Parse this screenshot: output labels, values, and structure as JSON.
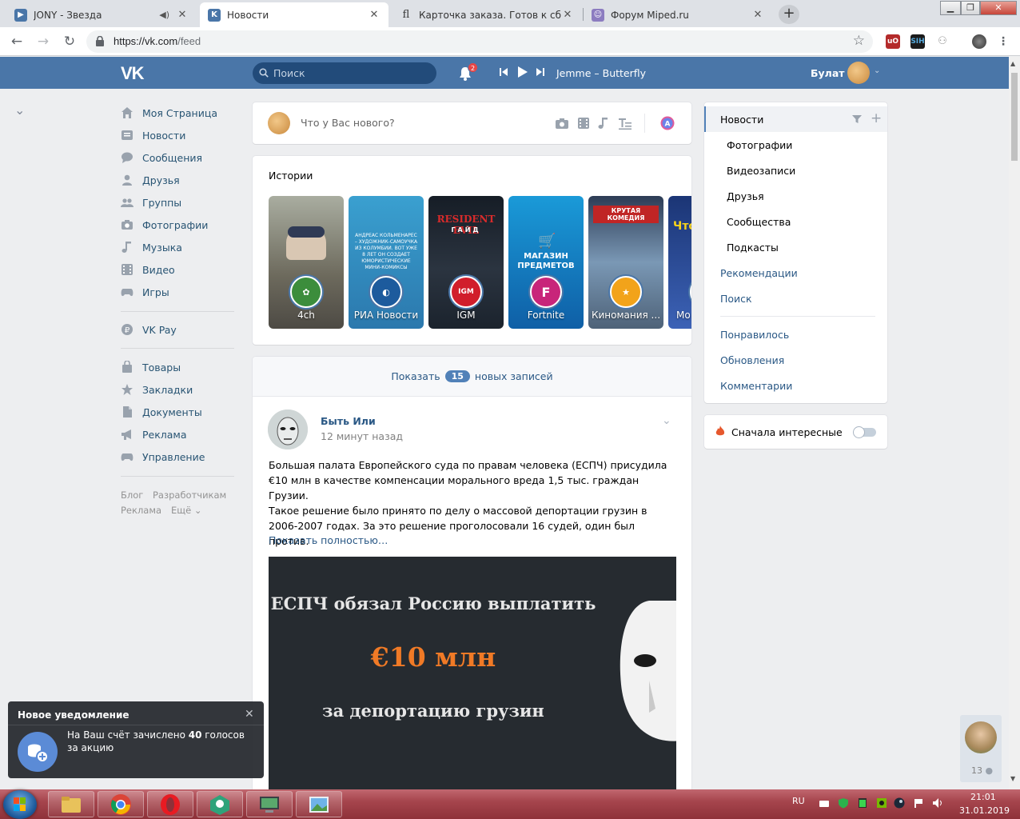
{
  "browser": {
    "tabs": [
      {
        "title": "JONY - Звезда",
        "favicon_color": "#4a76a8"
      },
      {
        "title": "Новости",
        "favicon_color": "#4a76a8"
      },
      {
        "title": "Карточка заказа. Готов к сборке",
        "favicon_color": "#555555"
      },
      {
        "title": "Форум Miped.ru",
        "favicon_color": "#6b7da8"
      }
    ],
    "url_host": "https://vk.com",
    "url_path": "/feed"
  },
  "header": {
    "search_placeholder": "Поиск",
    "notifications_count": "2",
    "track": "Jemme – Butterfly",
    "user_name": "Булат"
  },
  "sidebar": {
    "items": [
      {
        "label": "Моя Страница",
        "icon": "home-icon"
      },
      {
        "label": "Новости",
        "icon": "news-icon"
      },
      {
        "label": "Сообщения",
        "icon": "messages-icon"
      },
      {
        "label": "Друзья",
        "icon": "friends-icon"
      },
      {
        "label": "Группы",
        "icon": "groups-icon"
      },
      {
        "label": "Фотографии",
        "icon": "camera-icon"
      },
      {
        "label": "Музыка",
        "icon": "music-icon"
      },
      {
        "label": "Видео",
        "icon": "video-icon"
      },
      {
        "label": "Игры",
        "icon": "gamepad-icon"
      }
    ],
    "pay": {
      "label": "VK Pay",
      "icon": "ruble-icon"
    },
    "extra": [
      {
        "label": "Товары",
        "icon": "bag-icon"
      },
      {
        "label": "Закладки",
        "icon": "star-icon"
      },
      {
        "label": "Документы",
        "icon": "document-icon"
      },
      {
        "label": "Реклама",
        "icon": "megaphone-icon"
      },
      {
        "label": "Управление",
        "icon": "gamepad-icon"
      }
    ],
    "footer": {
      "blog": "Блог",
      "dev": "Разработчикам",
      "ads": "Реклама",
      "more": "Ещё"
    }
  },
  "composer": {
    "placeholder": "Что у Вас нового?"
  },
  "stories": {
    "title": "Истории",
    "items": [
      {
        "name": "4ch",
        "bg": "#8b8f86"
      },
      {
        "name": "РИА Новости",
        "bg": "#3b8fc0",
        "text": "АНДРЕАС КОЛЬМЕНАРЕС – ХУДОЖНИК-САМОУЧКА ИЗ КОЛУМБИИ. ВОТ УЖЕ 8 ЛЕТ ОН СОЗДАЕТ ЮМОРИСТИЧЕСКИЕ МИНИ-КОМИКСЫ"
      },
      {
        "name": "IGM",
        "bg": "#1b2430",
        "text": "RESIDENT EVIL",
        "sub": "ГАЙД",
        "badge": "IGM"
      },
      {
        "name": "Fortnite",
        "bg": "#1b86c9",
        "text": "МАГАЗИН ПРЕДМЕТОВ",
        "badge": "F"
      },
      {
        "name": "Киномания ...",
        "bg": "#5f7fa0",
        "text": "КРУТАЯ КОМЕДИЯ"
      },
      {
        "name": "Мо",
        "bg": "#2c4fa0",
        "text": "Что Х М"
      }
    ]
  },
  "feed": {
    "show_new_prefix": "Показать",
    "show_new_count": "15",
    "show_new_suffix": "новых записей",
    "post": {
      "author": "Быть Или",
      "time": "12 минут назад",
      "paragraph1": "Большая палата Европейского суда по правам человека (ЕСПЧ) присудила €10 млн в качестве компенсации морального вреда 1,5 тыс. граждан Грузии.",
      "paragraph2": "Такое решение было принято по делу о массовой депортации грузин в 2006-2007 годах. За это решение проголосовали 16 судей, один был против.",
      "show_full": "Показать полностью…",
      "image_line1": "ЕСПЧ обязал Россию выплатить",
      "image_line2": "€10 млн",
      "image_line3": "за депортацию грузин"
    }
  },
  "right_menu": {
    "news": "Новости",
    "subs": [
      "Фотографии",
      "Видеозаписи",
      "Друзья",
      "Сообщества",
      "Подкасты"
    ],
    "recommendations": "Рекомендации",
    "search": "Поиск",
    "liked": "Понравилось",
    "updates": "Обновления",
    "comments": "Комментарии"
  },
  "interesting": {
    "label": "Сначала интересные"
  },
  "notification": {
    "title": "Новое уведомление",
    "text_before": "На Ваш счёт зачислено ",
    "amount": "40",
    "text_after": " голосов за акцию"
  },
  "friends_widget": {
    "count": "13"
  },
  "taskbar": {
    "lang": "RU",
    "time": "21:01",
    "date": "31.01.2019"
  }
}
